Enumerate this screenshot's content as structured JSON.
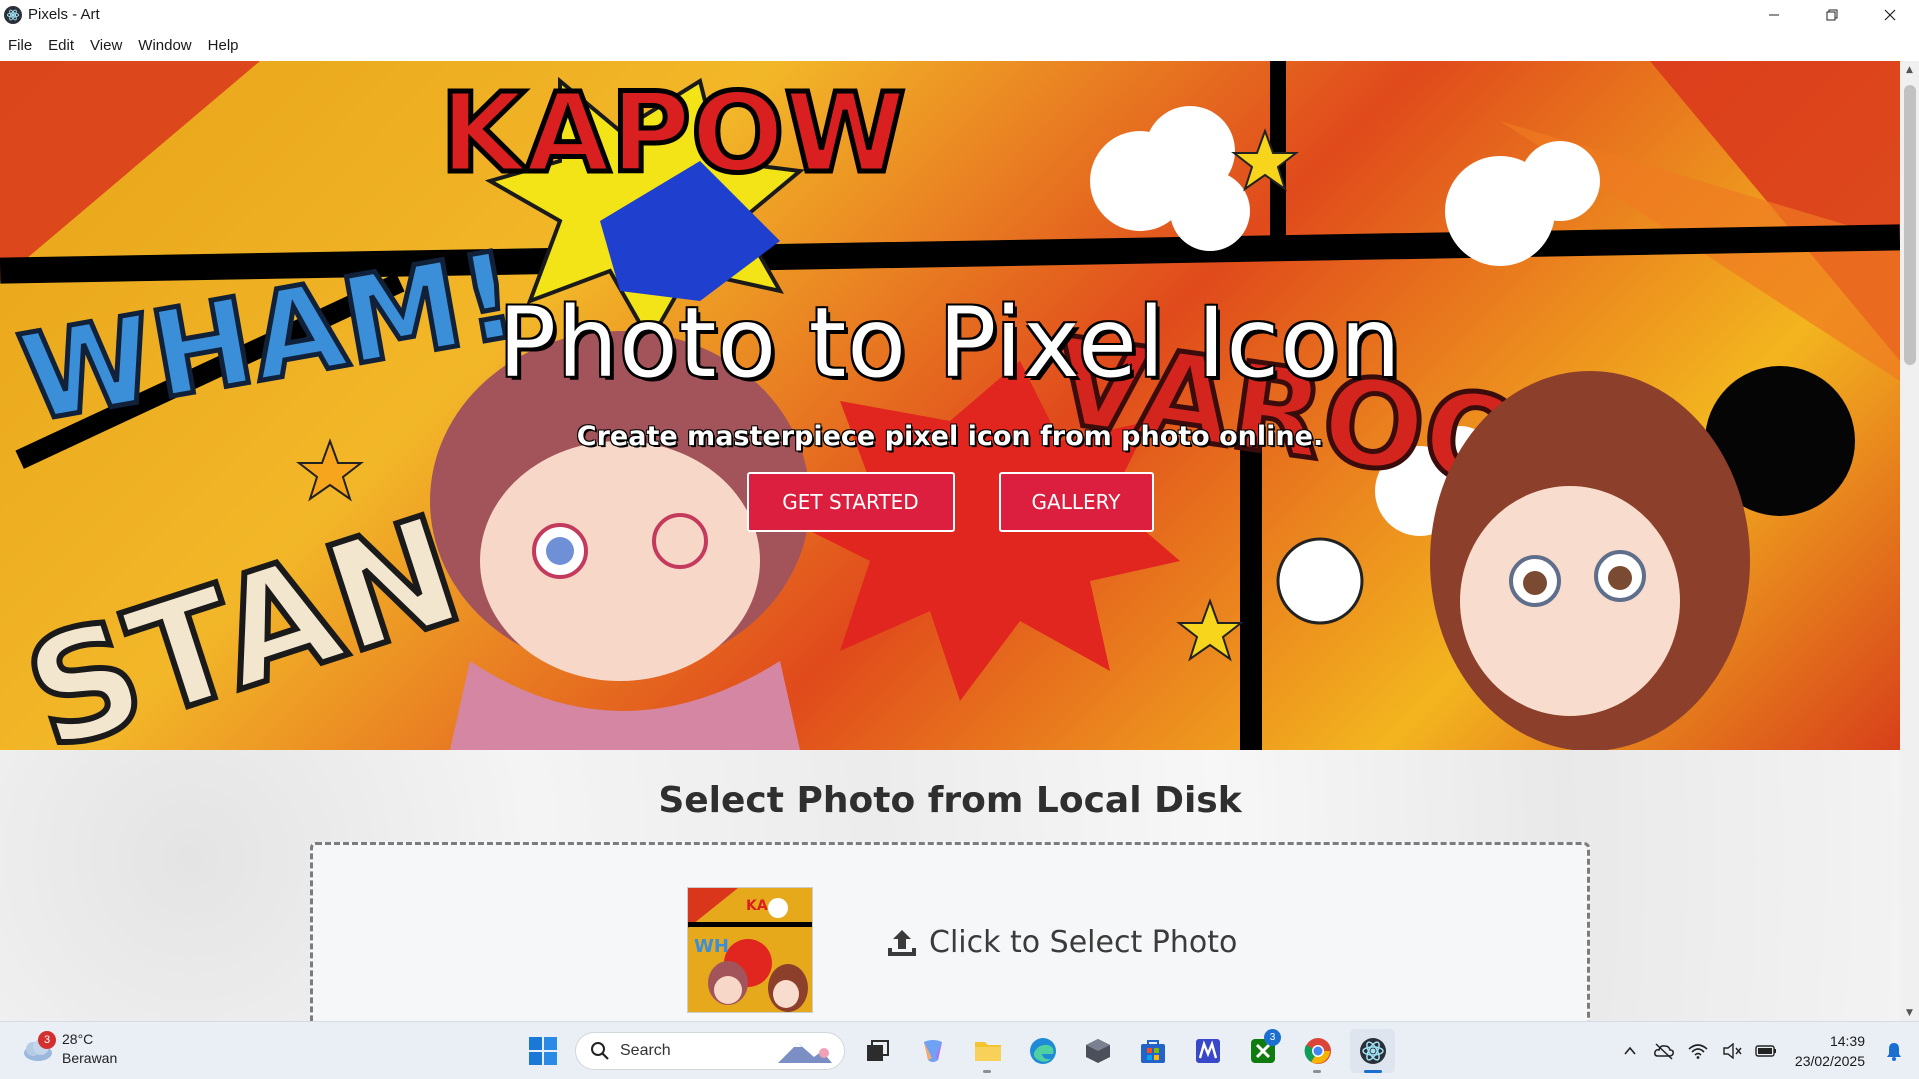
{
  "window": {
    "title": "Pixels - Art",
    "controls": [
      "minimize",
      "restore",
      "close"
    ]
  },
  "menu": {
    "items": [
      "File",
      "Edit",
      "View",
      "Window",
      "Help"
    ]
  },
  "hero": {
    "title": "Photo to Pixel Icon",
    "subtitle": "Create masterpiece pixel icon from photo online.",
    "get_started_label": "GET STARTED",
    "gallery_label": "GALLERY",
    "accent_color": "#dc1f3f"
  },
  "upload": {
    "section_title": "Select Photo from Local Disk",
    "select_label": "Click to Select Photo",
    "upload_icon": "upload-icon"
  },
  "taskbar": {
    "weather": {
      "temp": "28°C",
      "condition": "Berawan",
      "badge": "3"
    },
    "search_placeholder": "Search",
    "apps": [
      {
        "name": "start-button",
        "icon": "windows-logo-icon"
      },
      {
        "name": "task-view-button",
        "icon": "task-view-icon"
      },
      {
        "name": "copilot-button",
        "icon": "copilot-icon"
      },
      {
        "name": "file-explorer-button",
        "icon": "folder-icon"
      },
      {
        "name": "edge-button",
        "icon": "edge-icon"
      },
      {
        "name": "app-cube-button",
        "icon": "cube-icon"
      },
      {
        "name": "store-button",
        "icon": "store-icon"
      },
      {
        "name": "app-m-button",
        "icon": "m-app-icon"
      },
      {
        "name": "xbox-button",
        "icon": "xbox-icon",
        "badge": "3"
      },
      {
        "name": "chrome-button",
        "icon": "chrome-icon"
      },
      {
        "name": "electron-app-button",
        "icon": "electron-icon"
      }
    ],
    "clock": {
      "time": "14:39",
      "date": "23/02/2025"
    }
  }
}
